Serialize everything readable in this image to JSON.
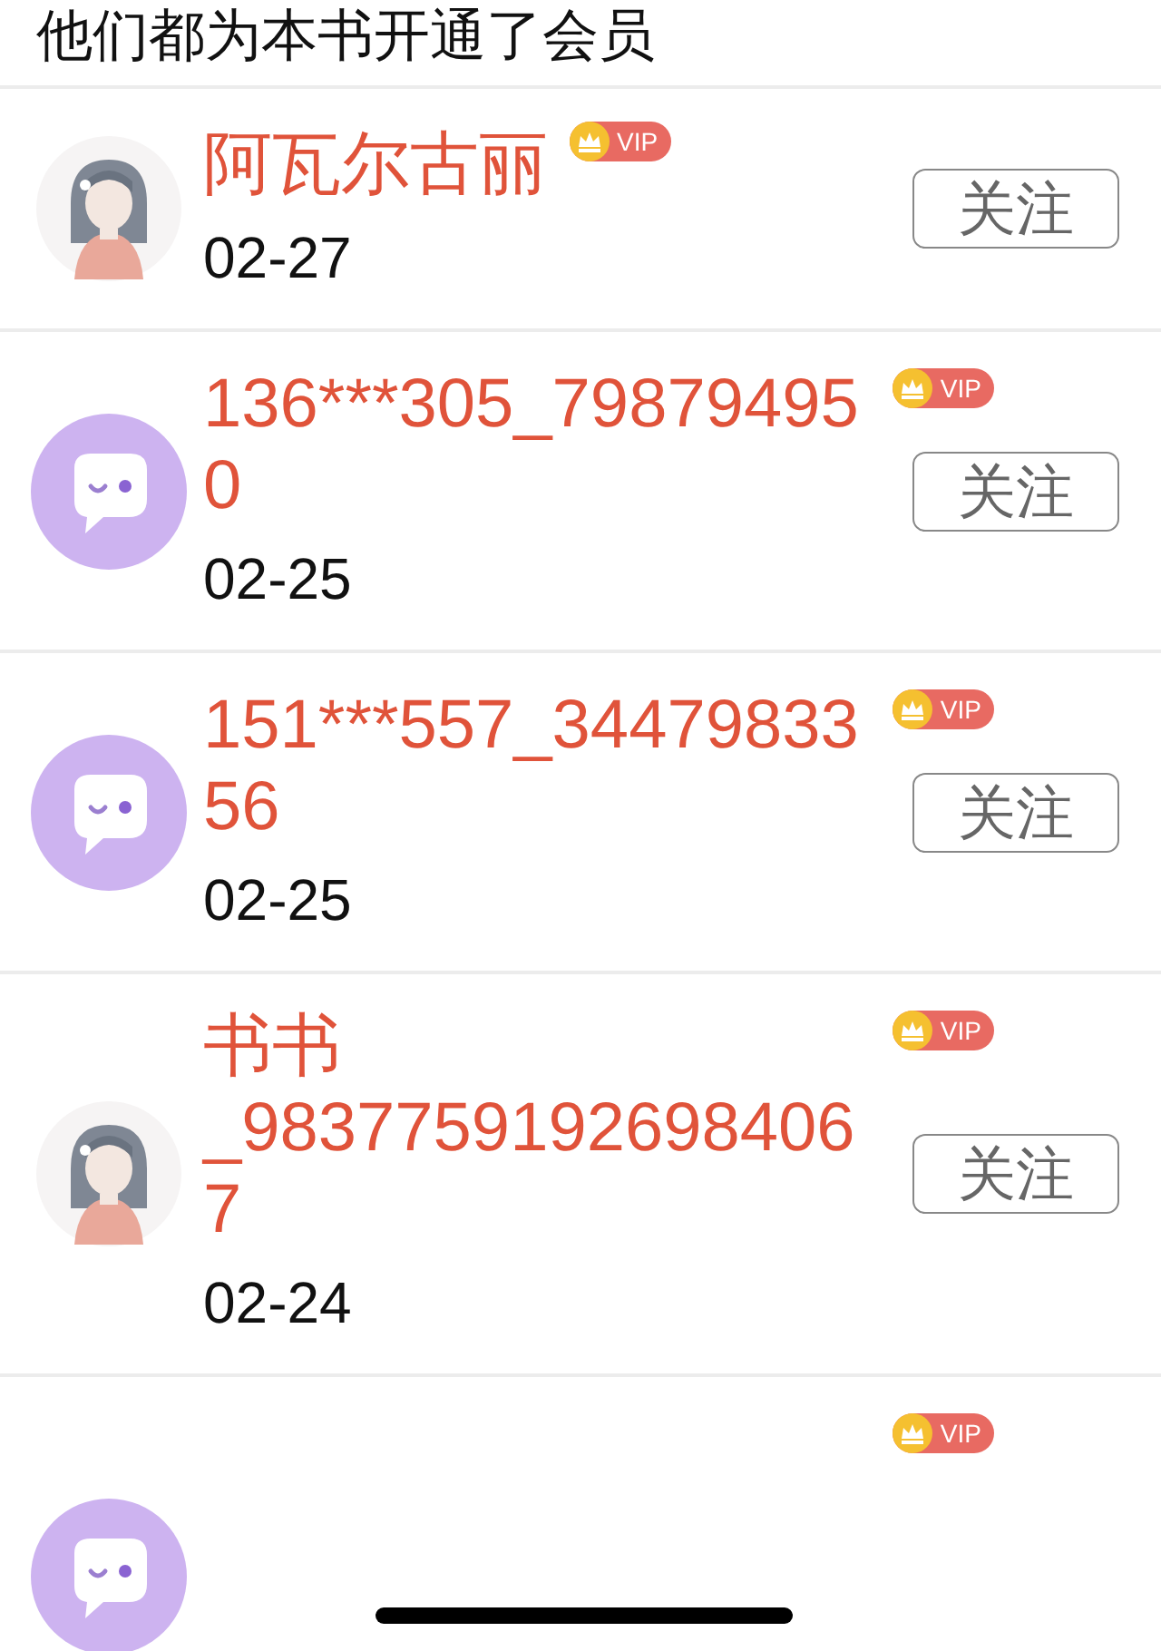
{
  "header": {
    "title": "他们都为本书开通了会员"
  },
  "members": [
    {
      "kind": "short",
      "name": "阿瓦尔古丽",
      "vip": "VIP",
      "date": "02-27",
      "button": "关注"
    },
    {
      "kind": "long",
      "avatar": {
        "kind": "bubble"
      },
      "name": "136***305_798794950",
      "vip": "VIP",
      "date": "02-25",
      "button": "关注"
    },
    {
      "kind": "long",
      "avatar": {
        "kind": "bubble"
      },
      "name": "151***557_3447983356",
      "vip": "VIP",
      "date": "02-25",
      "button": "关注"
    },
    {
      "kind": "long",
      "name": "书书_98377591926984067",
      "vip": "VIP",
      "date": "02-24",
      "button": "关注"
    },
    {
      "kind": "cut",
      "avatar": {
        "kind": "bubble"
      },
      "vip": "VIP"
    }
  ]
}
